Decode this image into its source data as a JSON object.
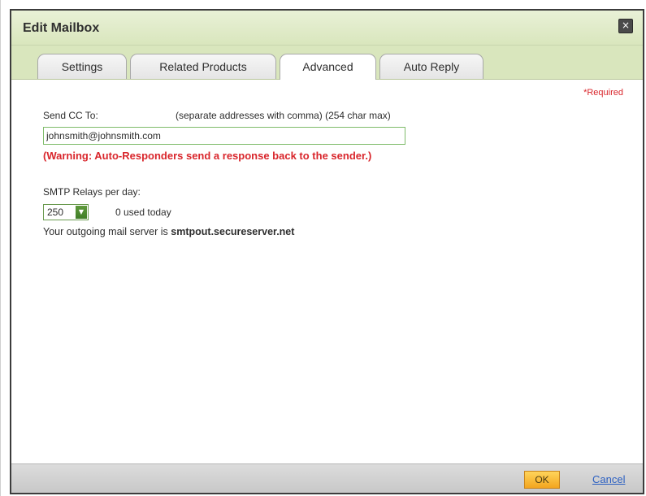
{
  "dialog": {
    "title": "Edit Mailbox",
    "close_icon": "×"
  },
  "tabs": [
    {
      "label": "Settings",
      "active": false
    },
    {
      "label": "Related Products",
      "active": false
    },
    {
      "label": "Advanced",
      "active": true
    },
    {
      "label": "Auto Reply",
      "active": false
    }
  ],
  "advanced": {
    "required_note": "*Required",
    "send_cc_label": "Send CC To:",
    "send_cc_hint": "(separate addresses with comma) (254 char max)",
    "send_cc_value": "johnsmith@johnsmith.com",
    "warning": "(Warning: Auto-Responders send a response back to the sender.)",
    "smtp_label": "SMTP Relays per day:",
    "smtp_selected": "250",
    "smtp_used": "0 used today",
    "server_prefix": "Your outgoing mail server is ",
    "server_name": "smtpout.secureserver.net"
  },
  "footer": {
    "ok_label": "OK",
    "cancel_label": "Cancel"
  },
  "colors": {
    "header_green": "#d9e6bd",
    "warning_red": "#d9262c",
    "ok_orange": "#f3a51f",
    "link_blue": "#2a5fc2"
  }
}
